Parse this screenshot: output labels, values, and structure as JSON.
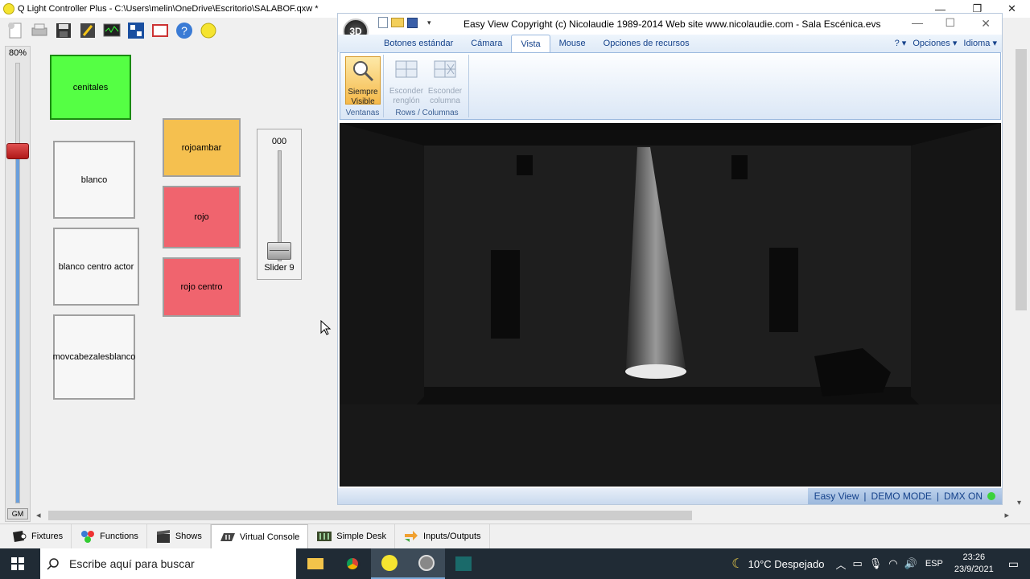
{
  "qlc": {
    "title": "Q Light Controller Plus - C:\\Users\\melin\\OneDrive\\Escritorio\\SALABOF.qxw *",
    "toolbar_icons": [
      "new-file-icon",
      "print-icon",
      "save-icon",
      "edit-icon",
      "monitor-icon",
      "address-tool-icon",
      "fullscreen-icon",
      "help-icon",
      "bulb-icon"
    ],
    "grand_master": {
      "value_label": "80%",
      "button_label": "GM",
      "level": 0.8
    },
    "vc_buttons": [
      {
        "label": "cenitales",
        "color": "#55ff44",
        "active": true
      },
      {
        "label": "blanco",
        "color": "#f7f7f7"
      },
      {
        "label": "blanco centro actor",
        "color": "#f7f7f7"
      },
      {
        "label": "movcabezalesblanco",
        "color": "#f7f7f7"
      },
      {
        "label": "rojoambar",
        "color": "#f5c04f"
      },
      {
        "label": "rojo",
        "color": "#f0646e"
      },
      {
        "label": "rojo centro",
        "color": "#f0646e"
      }
    ],
    "slider": {
      "value": "000",
      "label": "Slider 9",
      "level": 0
    },
    "tabs": [
      {
        "label": "Fixtures",
        "icon": "fixture-icon"
      },
      {
        "label": "Functions",
        "icon": "functions-icon"
      },
      {
        "label": "Shows",
        "icon": "shows-icon"
      },
      {
        "label": "Virtual Console",
        "icon": "virtual-console-icon",
        "active": true
      },
      {
        "label": "Simple Desk",
        "icon": "simple-desk-icon"
      },
      {
        "label": "Inputs/Outputs",
        "icon": "inputs-outputs-icon"
      }
    ]
  },
  "easyview": {
    "logo": "3D",
    "title": "Easy View   Copyright (c) Nicolaudie 1989-2014    Web site www.nicolaudie.com - Sala Escénica.evs",
    "tabs": [
      "Botones estándar",
      "Cámara",
      "Vista",
      "Mouse",
      "Opciones de recursos"
    ],
    "active_tab": "Vista",
    "right_menu": [
      "?",
      "Opciones",
      "Idioma"
    ],
    "groups": [
      {
        "label": "Ventanas",
        "buttons": [
          "Siempre Visible"
        ]
      },
      {
        "label": "Rows / Columnas",
        "buttons": [
          "Esconder renglón",
          "Esconder columna"
        ]
      }
    ],
    "status": [
      "Easy View",
      "DEMO MODE",
      "DMX ON"
    ]
  },
  "taskbar": {
    "search_placeholder": "Escribe aquí para buscar",
    "weather": "10°C  Despejado",
    "lang": "ESP",
    "time": "23:26",
    "date": "23/9/2021"
  },
  "colors": {
    "accent": "#55ff44",
    "red": "#f0646e",
    "amber": "#f5c04f",
    "ribbon": "#dbe7f6"
  }
}
